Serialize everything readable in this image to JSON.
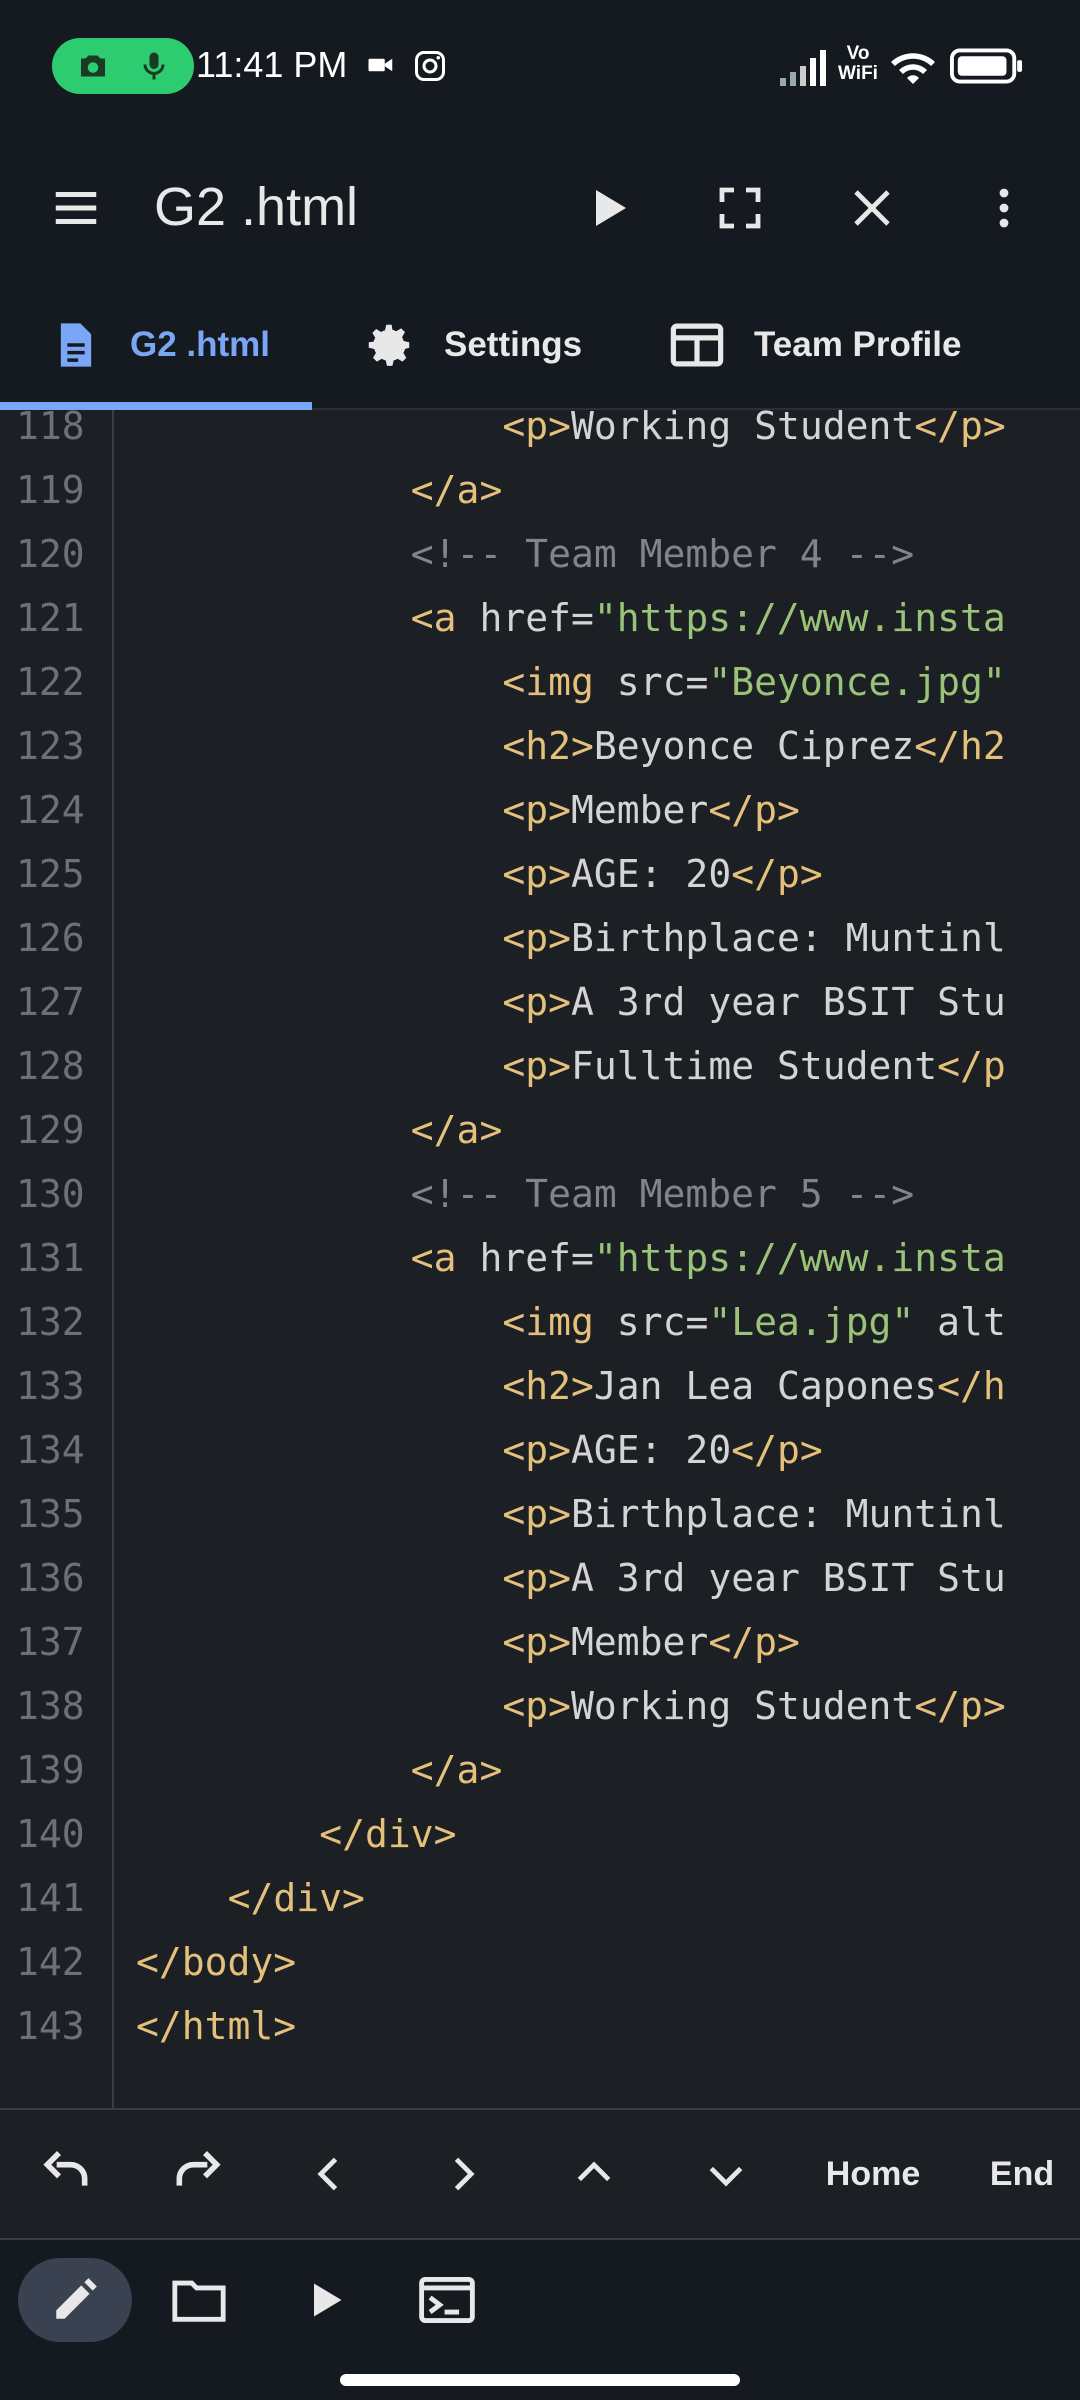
{
  "status_bar": {
    "time": "11:41 PM",
    "vowifi_top": "Vo",
    "vowifi_bottom": "WiFi",
    "icons": [
      "camera-icon",
      "mic-icon",
      "video-icon",
      "instagram-icon",
      "signal-icon",
      "wifi-icon",
      "battery-icon"
    ]
  },
  "toolbar": {
    "title": "G2 .html",
    "icons": [
      "menu-icon",
      "play-icon",
      "fullscreen-icon",
      "close-icon",
      "more-vert-icon"
    ]
  },
  "tabs": [
    {
      "label": "G2 .html",
      "icon": "file-icon",
      "active": true
    },
    {
      "label": "Settings",
      "icon": "gear-icon",
      "active": false
    },
    {
      "label": "Team Profile",
      "icon": "browser-icon",
      "active": false
    }
  ],
  "editor": {
    "lines": [
      {
        "num": "118",
        "indent": 16,
        "text": "<p>Working Student</p>"
      },
      {
        "num": "119",
        "indent": 12,
        "text": "</a>"
      },
      {
        "num": "120",
        "indent": 12,
        "text": "<!-- Team Member 4 -->"
      },
      {
        "num": "121",
        "indent": 12,
        "text": "<a href=\"https://www.insta"
      },
      {
        "num": "122",
        "indent": 16,
        "text": "<img src=\"Beyonce.jpg\""
      },
      {
        "num": "123",
        "indent": 16,
        "text": "<h2>Beyonce Ciprez</h2"
      },
      {
        "num": "124",
        "indent": 16,
        "text": "<p>Member</p>"
      },
      {
        "num": "125",
        "indent": 16,
        "text": "<p>AGE: 20</p>"
      },
      {
        "num": "126",
        "indent": 16,
        "text": "<p>Birthplace: Muntinl"
      },
      {
        "num": "127",
        "indent": 16,
        "text": "<p>A 3rd year BSIT Stu"
      },
      {
        "num": "128",
        "indent": 16,
        "text": "<p>Fulltime Student</p"
      },
      {
        "num": "129",
        "indent": 12,
        "text": "</a>"
      },
      {
        "num": "130",
        "indent": 12,
        "text": "<!-- Team Member 5 -->"
      },
      {
        "num": "131",
        "indent": 12,
        "text": "<a href=\"https://www.insta"
      },
      {
        "num": "132",
        "indent": 16,
        "text": "<img src=\"Lea.jpg\" alt"
      },
      {
        "num": "133",
        "indent": 16,
        "text": "<h2>Jan Lea Capones</h"
      },
      {
        "num": "134",
        "indent": 16,
        "text": "<p>AGE: 20</p>"
      },
      {
        "num": "135",
        "indent": 16,
        "text": "<p>Birthplace: Muntinl"
      },
      {
        "num": "136",
        "indent": 16,
        "text": "<p>A 3rd year BSIT Stu"
      },
      {
        "num": "137",
        "indent": 16,
        "text": "<p>Member</p>"
      },
      {
        "num": "138",
        "indent": 16,
        "text": "<p>Working Student</p>"
      },
      {
        "num": "139",
        "indent": 12,
        "text": "</a>"
      },
      {
        "num": "140",
        "indent": 8,
        "text": "</div>"
      },
      {
        "num": "141",
        "indent": 4,
        "text": "</div>"
      },
      {
        "num": "142",
        "indent": 0,
        "text": "</body>"
      },
      {
        "num": "143",
        "indent": 0,
        "text": "</html>"
      }
    ]
  },
  "keybar": {
    "keys": [
      {
        "name": "undo-icon"
      },
      {
        "name": "redo-icon"
      },
      {
        "name": "chevron-left-icon"
      },
      {
        "name": "chevron-right-icon"
      },
      {
        "name": "chevron-up-icon"
      },
      {
        "name": "chevron-down-icon"
      },
      {
        "label": "Home"
      },
      {
        "label": "End"
      }
    ]
  },
  "bottom_bar": {
    "icons": [
      "edit-icon",
      "folder-icon",
      "run-icon",
      "terminal-icon"
    ]
  },
  "colors": {
    "background": "#1c1f24",
    "bar": "#151920",
    "accent": "#7aa7f5",
    "tag": "#e5c07b",
    "string": "#98c379",
    "comment": "#7f848e",
    "rec_pill": "#2ecc71"
  }
}
